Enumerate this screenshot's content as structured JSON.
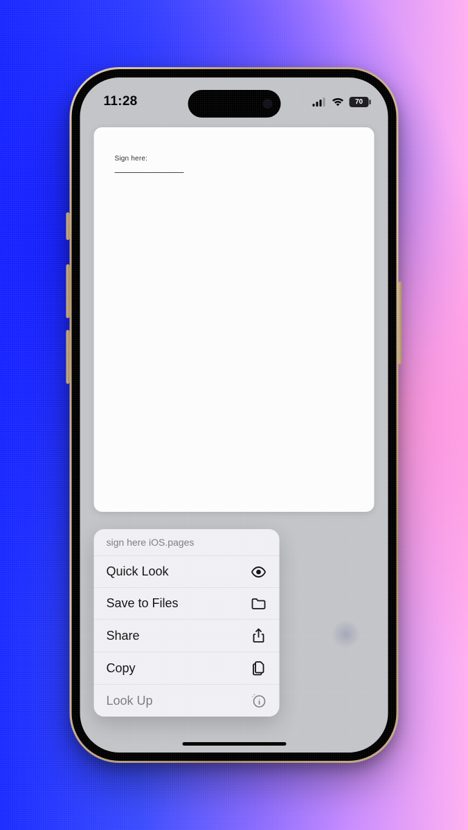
{
  "status_bar": {
    "time": "11:28",
    "battery_percent": "70"
  },
  "document": {
    "sign_label": "Sign here:"
  },
  "context_menu": {
    "title": "sign here iOS.pages",
    "items": [
      {
        "label": "Quick Look",
        "icon": "eye",
        "secondary": false
      },
      {
        "label": "Save to Files",
        "icon": "folder",
        "secondary": false
      },
      {
        "label": "Share",
        "icon": "share",
        "secondary": false
      },
      {
        "label": "Copy",
        "icon": "copy",
        "secondary": false
      },
      {
        "label": "Look Up",
        "icon": "lookup",
        "secondary": true
      }
    ]
  }
}
